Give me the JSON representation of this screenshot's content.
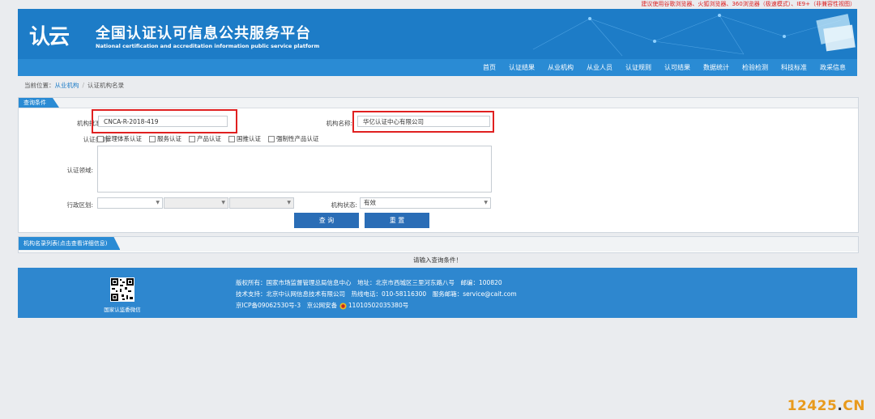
{
  "top_notice": "建议使用谷歌浏览器、火狐浏览器、360浏览器（极速模式）、IE9+（非兼容性视图）",
  "header": {
    "logo": "认云",
    "title": "全国认证认可信息公共服务平台",
    "subtitle": "National certification and accreditation information public service platform"
  },
  "nav": [
    "首页",
    "认证结果",
    "从业机构",
    "从业人员",
    "认证规则",
    "认可结果",
    "数据统计",
    "检验检测",
    "科技标准",
    "政采信息"
  ],
  "breadcrumb": {
    "prefix": "当前位置：",
    "link": "从业机构",
    "current": "认证机构名录"
  },
  "query": {
    "panel_title": "查询条件",
    "approval_no_label": "机构批准号:",
    "approval_no_value": "CNCA-R-2018-419",
    "org_name_label": "机构名称:",
    "org_name_value": "华亿认证中心有限公司",
    "cert_type_label": "认证类别:",
    "cert_types": [
      "管理体系认证",
      "服务认证",
      "产品认证",
      "国推认证",
      "强制性产品认证"
    ],
    "cert_field_label": "认证领域:",
    "region_label": "行政区划:",
    "status_label": "机构状态:",
    "status_value": "有效",
    "search_btn": "查 询",
    "reset_btn": "重 置"
  },
  "list": {
    "panel_title": "机构名录列表(点击查看详细信息)",
    "empty_msg": "请输入查询条件！"
  },
  "footer": {
    "qr_label": "国家认监委微信",
    "line1": "版权所有：国家市场监督管理总局信息中心　地址：北京市西城区三里河东路八号　邮编：100820",
    "line2": "技术支持：北京中认网信息技术有限公司　热线电话：010-58116300　服务邮箱：service@cait.com",
    "icp": "京ICP备09062530号-3",
    "police": "京公网安备",
    "police_no": "11010502035380号"
  },
  "watermark": {
    "num": "12425",
    "dot": ".",
    "tld": "CN"
  },
  "colors": {
    "header_blue": "#1d7cc7",
    "nav_blue": "#2a8bd4",
    "button_blue": "#2a6db6",
    "highlight_red": "#e02020",
    "watermark_orange": "#e89a1c"
  }
}
